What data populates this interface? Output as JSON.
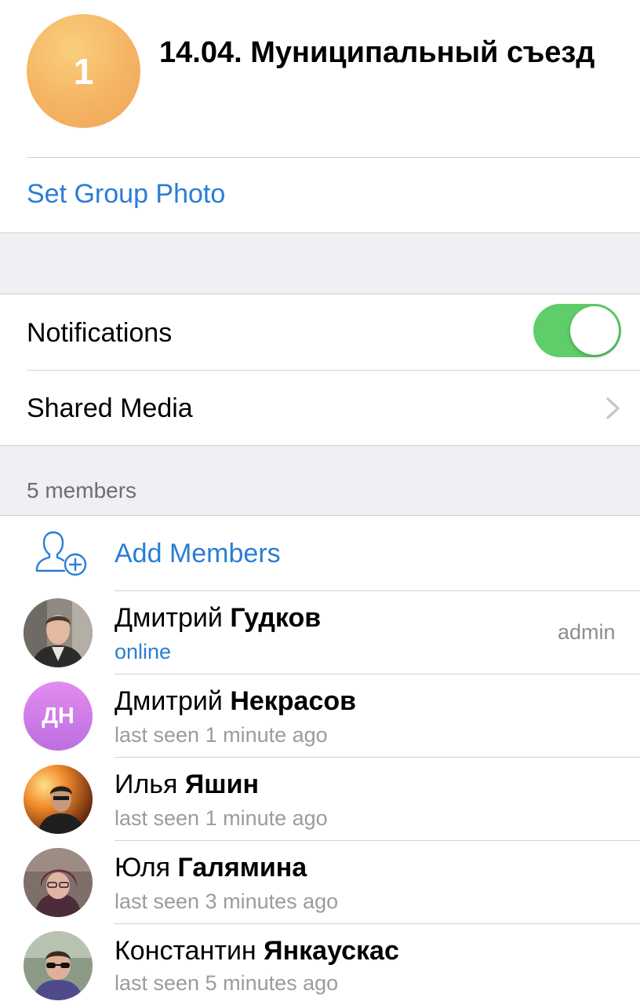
{
  "group": {
    "avatar_letter": "1",
    "title": "14.04. Муниципальный съезд"
  },
  "set_group_photo": "Set Group Photo",
  "settings": {
    "notifications_label": "Notifications",
    "notifications_on": true,
    "shared_media_label": "Shared Media"
  },
  "members_header": "5 members",
  "add_members_label": "Add Members",
  "members": [
    {
      "first": "Дмитрий",
      "last": "Гудков",
      "status": "online",
      "badge": "admin"
    },
    {
      "first": "Дмитрий",
      "last": "Некрасов",
      "status": "last seen 1 minute ago",
      "initials": "ДН"
    },
    {
      "first": "Илья",
      "last": "Яшин",
      "status": "last seen 1 minute ago"
    },
    {
      "first": "Юля",
      "last": "Галямина",
      "status": "last seen 3 minutes ago"
    },
    {
      "first": "Константин",
      "last": "Янкаускас",
      "status": "last seen 5 minutes ago"
    }
  ],
  "colors": {
    "accent": "#2a7dd6",
    "toggle_on": "#5fce6a",
    "group_background": "#efeff4"
  },
  "icons": [
    "add-member-icon",
    "chevron-right-icon"
  ]
}
